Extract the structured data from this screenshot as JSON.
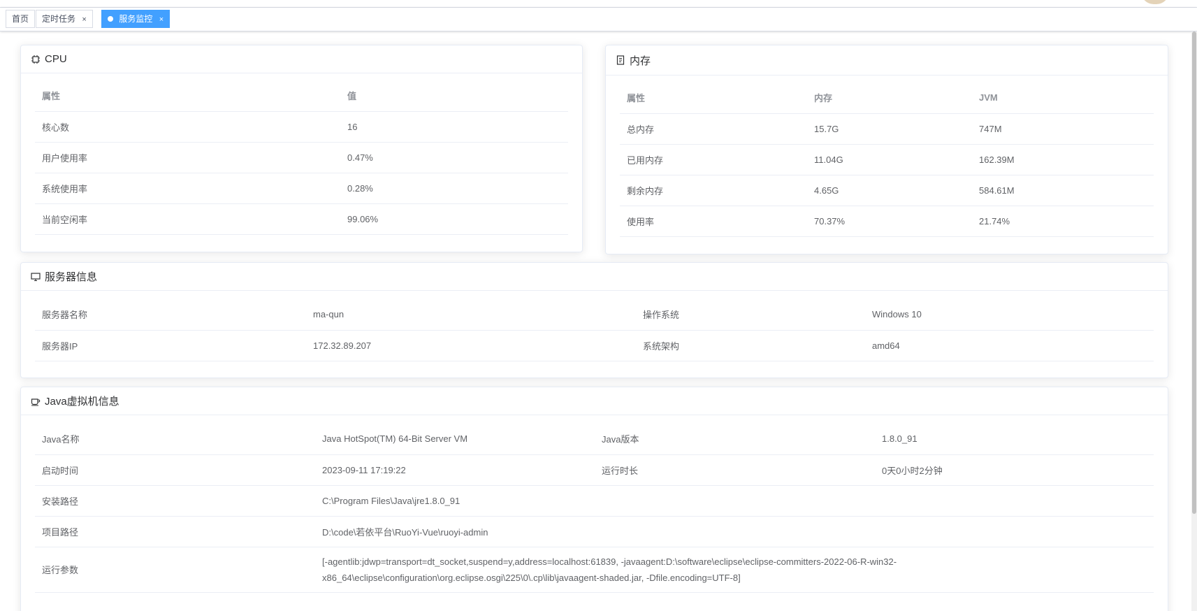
{
  "tags": [
    {
      "label": "首页",
      "active": false,
      "closable": false
    },
    {
      "label": "定时任务",
      "active": false,
      "closable": true
    },
    {
      "label": "服务监控",
      "active": true,
      "closable": true
    }
  ],
  "close_glyph": "×",
  "cpu": {
    "title": "CPU",
    "headers": [
      "属性",
      "值"
    ],
    "rows": [
      [
        "核心数",
        "16"
      ],
      [
        "用户使用率",
        "0.47%"
      ],
      [
        "系统使用率",
        "0.28%"
      ],
      [
        "当前空闲率",
        "99.06%"
      ]
    ]
  },
  "memory": {
    "title": "内存",
    "headers": [
      "属性",
      "内存",
      "JVM"
    ],
    "rows": [
      [
        "总内存",
        "15.7G",
        "747M"
      ],
      [
        "已用内存",
        "11.04G",
        "162.39M"
      ],
      [
        "剩余内存",
        "4.65G",
        "584.61M"
      ],
      [
        "使用率",
        "70.37%",
        "21.74%"
      ]
    ]
  },
  "server": {
    "title": "服务器信息",
    "rows": [
      [
        "服务器名称",
        "ma-qun",
        "操作系统",
        "Windows 10"
      ],
      [
        "服务器IP",
        "172.32.89.207",
        "系统架构",
        "amd64"
      ]
    ]
  },
  "jvm": {
    "title": "Java虚拟机信息",
    "rows4": [
      [
        "Java名称",
        "Java HotSpot(TM) 64-Bit Server VM",
        "Java版本",
        "1.8.0_91"
      ],
      [
        "启动时间",
        "2023-09-11 17:19:22",
        "运行时长",
        "0天0小时2分钟"
      ]
    ],
    "rows2": [
      [
        "安装路径",
        "C:\\Program Files\\Java\\jre1.8.0_91"
      ],
      [
        "项目路径",
        "D:\\code\\若依平台\\RuoYi-Vue\\ruoyi-admin"
      ],
      [
        "运行参数",
        "[-agentlib:jdwp=transport=dt_socket,suspend=y,address=localhost:61839, -javaagent:D:\\software\\eclipse\\eclipse-committers-2022-06-R-win32-x86_64\\eclipse\\configuration\\org.eclipse.osgi\\225\\0\\.cp\\lib\\javaagent-shaded.jar, -Dfile.encoding=UTF-8]"
      ]
    ]
  },
  "icons": {
    "cpu": "cpu-icon",
    "memory": "memory-icon",
    "server": "monitor-icon",
    "jvm": "coffee-cup-icon"
  },
  "colors": {
    "accent": "#42a0ff",
    "border": "#ebeef5",
    "text": "#606266",
    "header_text": "#909399"
  }
}
